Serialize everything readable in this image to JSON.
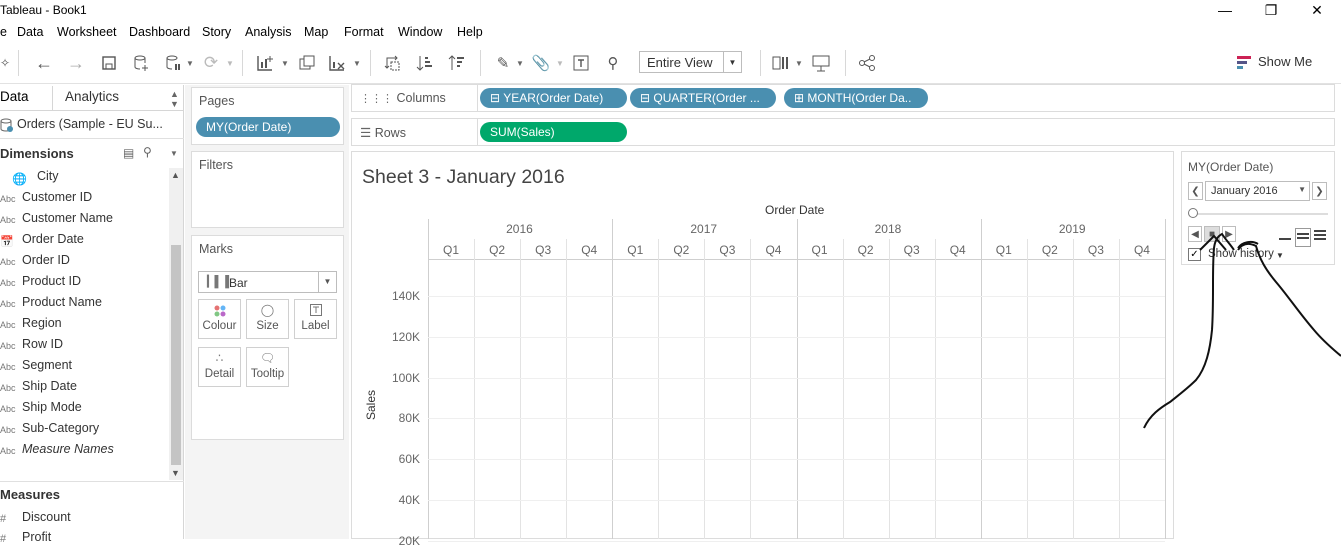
{
  "window": {
    "title": "Tableau - Book1"
  },
  "menu": [
    "Data",
    "Worksheet",
    "Dashboard",
    "Story",
    "Analysis",
    "Map",
    "Format",
    "Window",
    "Help"
  ],
  "toolbar": {
    "fit": "Entire View",
    "show_me": "Show Me"
  },
  "left": {
    "tab_data": "Data",
    "tab_analytics": "Analytics",
    "datasource": "Orders (Sample - EU Su...",
    "dimensions_header": "Dimensions",
    "dimensions": [
      "City",
      "Customer ID",
      "Customer Name",
      "Order Date",
      "Order ID",
      "Product ID",
      "Product Name",
      "Region",
      "Row ID",
      "Segment",
      "Ship Date",
      "Ship Mode",
      "Sub-Category",
      "Measure Names"
    ],
    "measures_header": "Measures",
    "measures": [
      "Discount",
      "Profit"
    ]
  },
  "cards": {
    "pages": {
      "title": "Pages",
      "pill": "MY(Order Date)"
    },
    "filters": {
      "title": "Filters"
    },
    "marks": {
      "title": "Marks",
      "type": "Bar",
      "buttons": {
        "colour": "Colour",
        "size": "Size",
        "label": "Label",
        "detail": "Detail",
        "tooltip": "Tooltip"
      }
    }
  },
  "shelves": {
    "columns_label": "Columns",
    "rows_label": "Rows",
    "columns": [
      "YEAR(Order Date)",
      "QUARTER(Order ...",
      "MONTH(Order Da.."
    ],
    "rows": [
      "SUM(Sales)"
    ]
  },
  "sheet": {
    "title": "Sheet 3 - January 2016"
  },
  "chart_data": {
    "type": "bar",
    "title": "Sheet 3 - January 2016",
    "xlabel": "Order Date",
    "ylabel": "Sales",
    "years": [
      "2016",
      "2017",
      "2018",
      "2019"
    ],
    "quarters": [
      "Q1",
      "Q2",
      "Q3",
      "Q4"
    ],
    "y_ticks": [
      "140K",
      "120K",
      "100K",
      "80K",
      "60K",
      "40K",
      "20K"
    ],
    "series": [],
    "grid": true
  },
  "pages_control": {
    "title": "MY(Order Date)",
    "selected": "January 2016",
    "history_label": "Show history",
    "show_history_checked": true
  }
}
